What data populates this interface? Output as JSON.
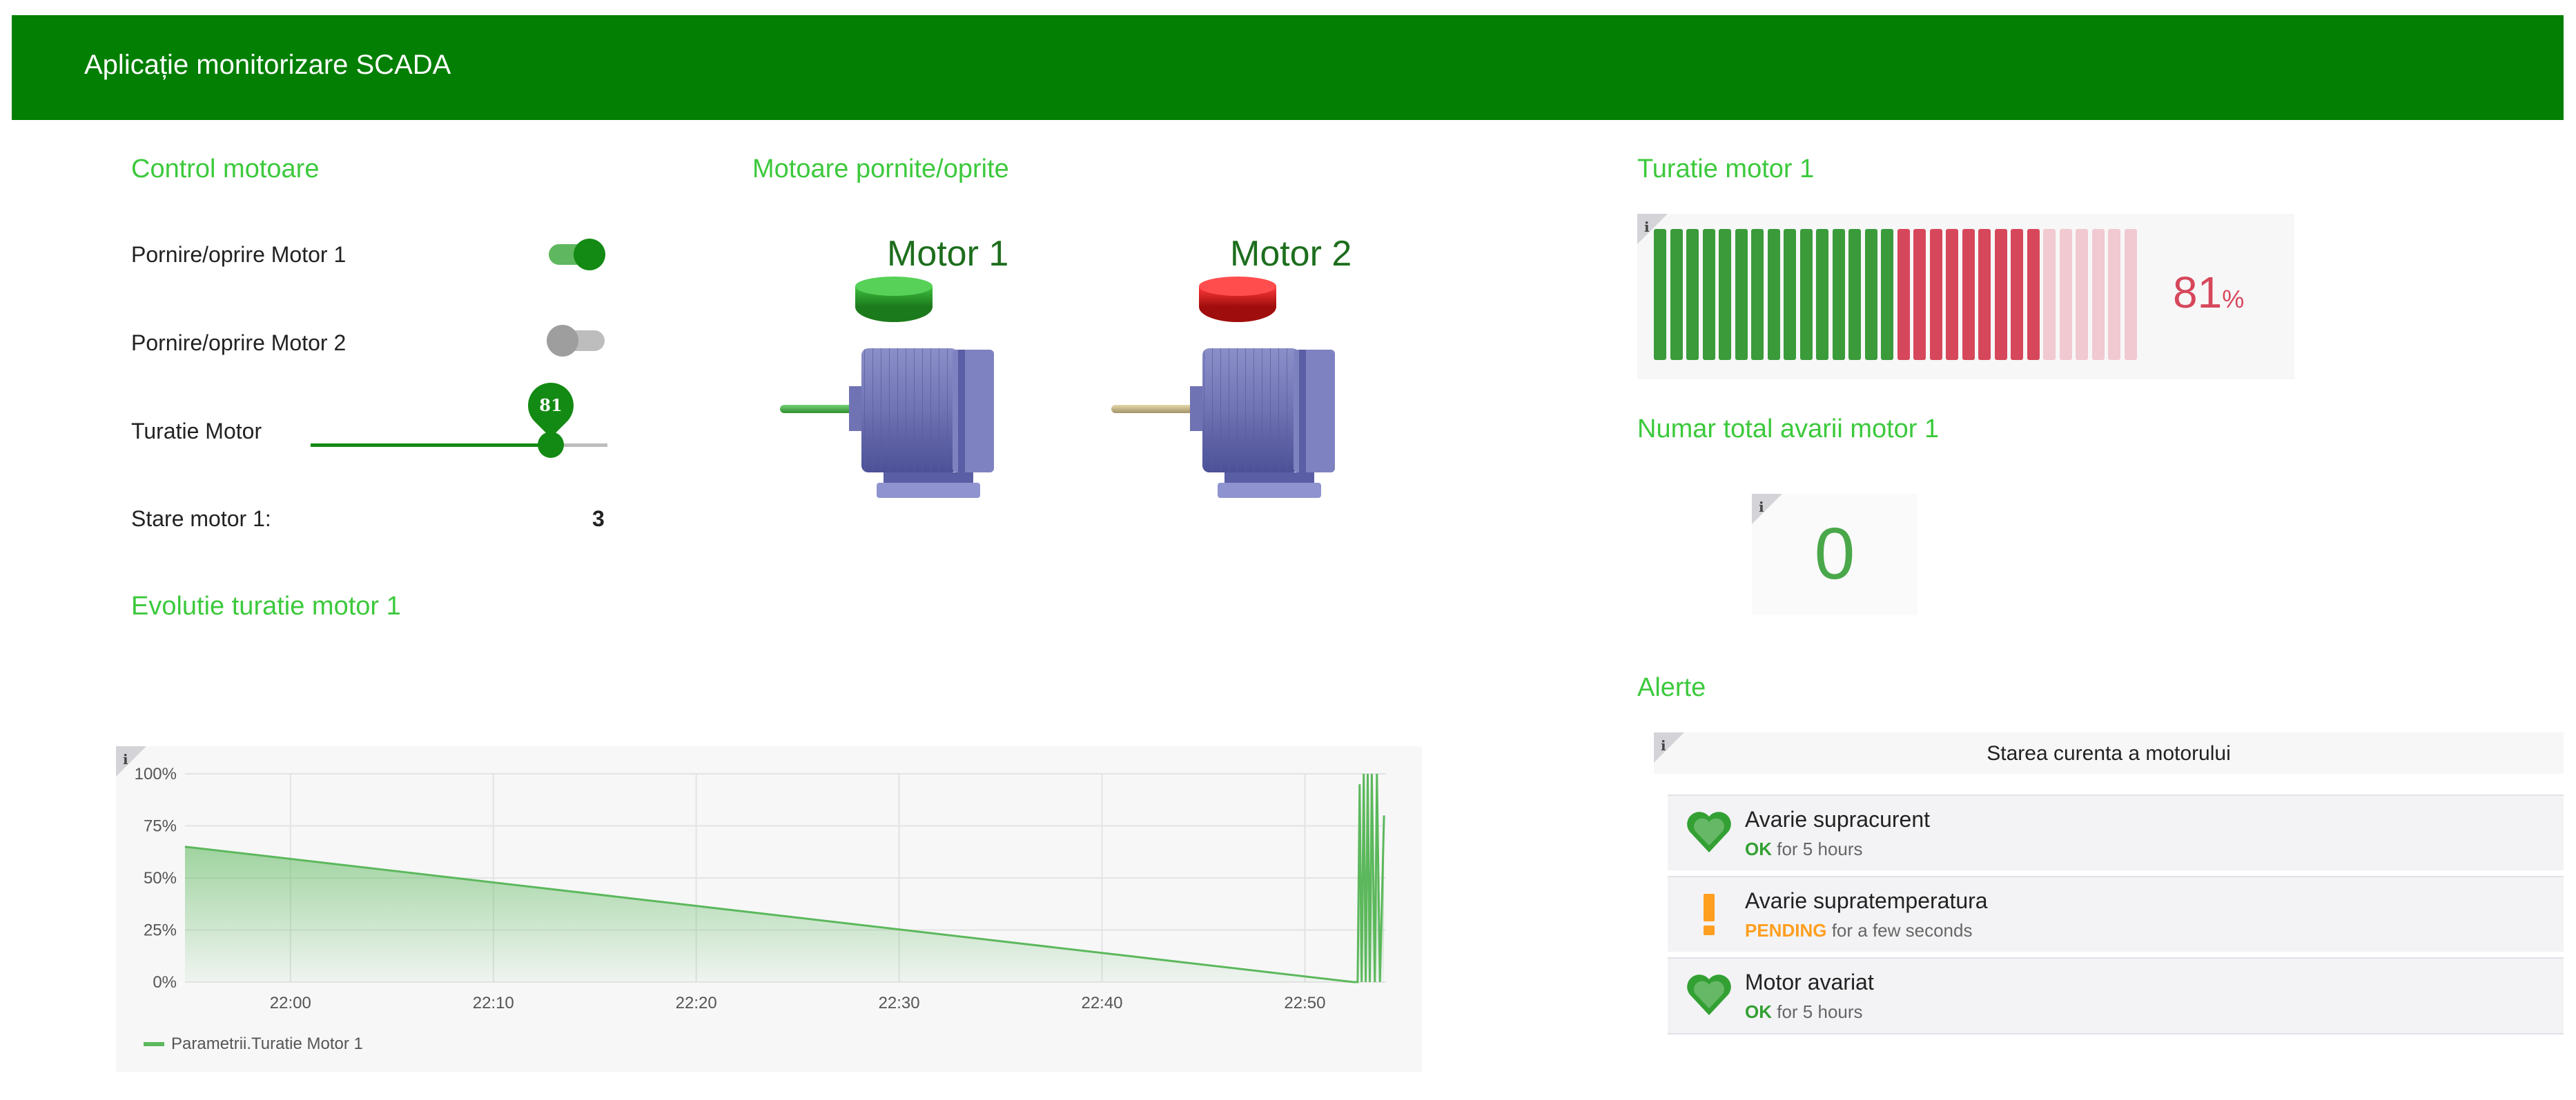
{
  "app": {
    "title": "Aplicație monitorizare SCADA",
    "accent": "#037f03"
  },
  "control": {
    "title": "Control motoare",
    "motor1_toggle_label": "Pornire/oprire Motor 1",
    "motor1_on": true,
    "motor2_toggle_label": "Pornire/oprire Motor 2",
    "motor2_on": false,
    "speed_label": "Turatie Motor",
    "speed_value": "81",
    "speed_fraction": 0.81,
    "state_label": "Stare motor 1:",
    "state_value": "3"
  },
  "motors": {
    "title": "Motoare pornite/oprite",
    "motor1_label": "Motor 1",
    "motor1_indicator_color": "#2ea32e",
    "motor2_label": "Motor 2",
    "motor2_indicator_color": "#d11a1a"
  },
  "gauge": {
    "title": "Turatie motor 1",
    "value": "81",
    "unit": "%",
    "fraction": 0.81,
    "segments_total": 30,
    "info_icon": "i",
    "colors": {
      "good": "#3b9b3b",
      "bad": "#d7475b",
      "bad_light": "#f1c9d0",
      "value_text": "#d7475b"
    }
  },
  "failures": {
    "title": "Numar total avarii motor 1",
    "value": "0",
    "info_icon": "i",
    "value_color": "#4aa84a"
  },
  "chart": {
    "title": "Evolutie turatie motor 1",
    "info_icon": "i",
    "legend": "Parametrii.Turatie Motor 1"
  },
  "chart_data": {
    "type": "area",
    "title": "",
    "xlabel": "",
    "ylabel": "",
    "x_ticks": [
      "22:00",
      "22:10",
      "22:20",
      "22:30",
      "22:40",
      "22:50"
    ],
    "y_ticks": [
      "0%",
      "25%",
      "50%",
      "75%",
      "100%"
    ],
    "ylim": [
      0,
      100
    ],
    "x_range_minutes": [
      -5.2,
      54.0
    ],
    "series": [
      {
        "name": "Parametrii.Turatie Motor 1",
        "color": "#5cb85c",
        "x": [
          -5.2,
          52.4,
          52.6,
          52.7,
          52.8,
          52.9,
          53.0,
          53.1,
          53.2,
          53.3,
          53.45,
          53.55,
          53.7,
          53.9
        ],
        "y": [
          65,
          0,
          0,
          95,
          0,
          100,
          0,
          100,
          0,
          100,
          0,
          100,
          0,
          80
        ]
      }
    ],
    "grid": true,
    "legend_position": "bottom-left"
  },
  "alerts": {
    "title": "Alerte",
    "panel_title": "Starea curenta a motorului",
    "info_icon": "i",
    "items": [
      {
        "name": "Avarie supracurent",
        "status": "OK",
        "duration": "for 5 hours",
        "icon": "heart-icon",
        "color": "#33a033"
      },
      {
        "name": "Avarie supratemperatura",
        "status": "PENDING",
        "duration": "for a few seconds",
        "icon": "exclamation-icon",
        "color": "#ff9e1f"
      },
      {
        "name": "Motor avariat",
        "status": "OK",
        "duration": "for 5 hours",
        "icon": "heart-icon",
        "color": "#33a033"
      }
    ]
  }
}
